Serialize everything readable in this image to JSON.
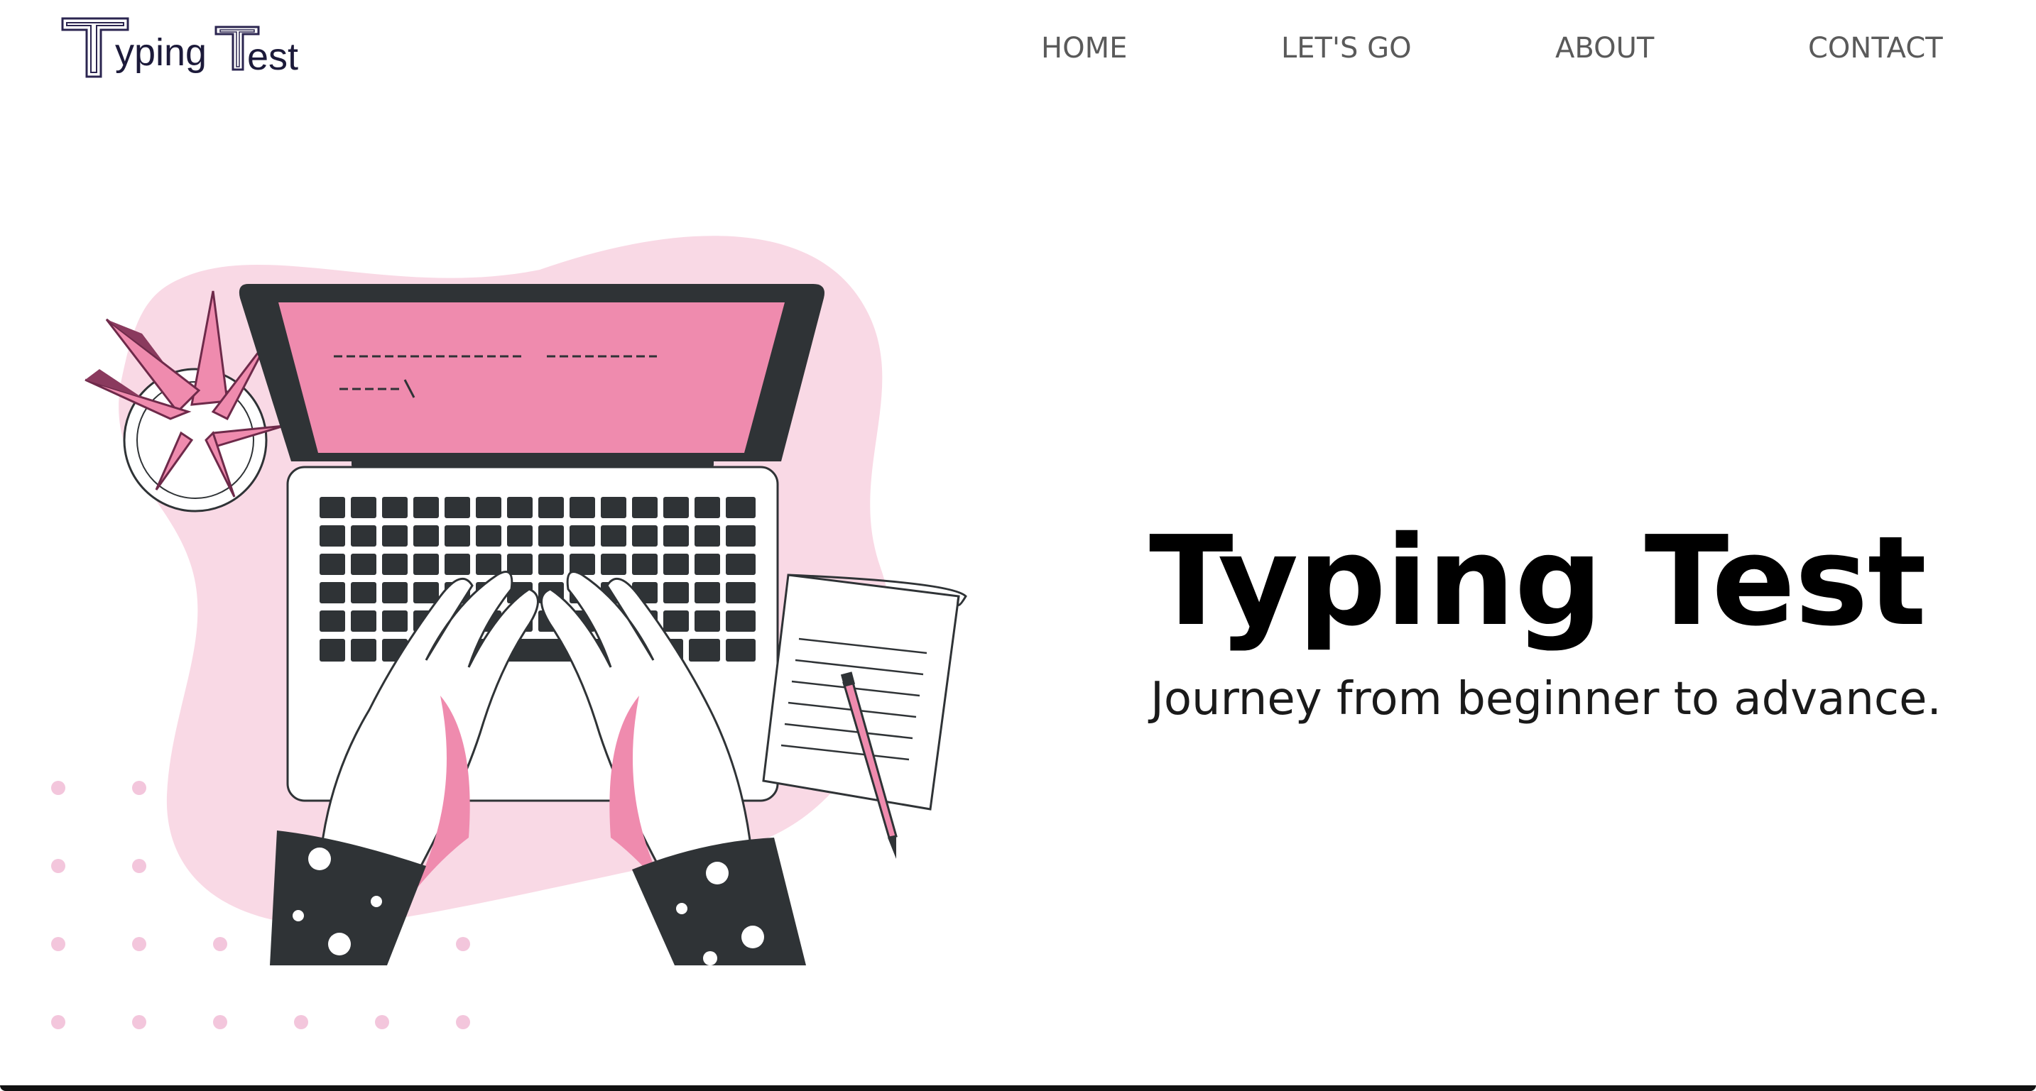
{
  "header": {
    "logo_text": "Typing Test"
  },
  "nav": {
    "items": [
      {
        "label": "HOME"
      },
      {
        "label": "LET'S GO"
      },
      {
        "label": "ABOUT"
      },
      {
        "label": "CONTACT"
      }
    ]
  },
  "hero": {
    "title": "Typing Test",
    "subtitle": "Journey from beginner to advance."
  },
  "illustration": {
    "icon": "laptop-typing-illustration-icon",
    "colors": {
      "accent_pink": "#ef8bae",
      "blob_pink": "#f9d9e5",
      "dark": "#2f3336",
      "dot_pink": "#f3c6dc"
    }
  }
}
